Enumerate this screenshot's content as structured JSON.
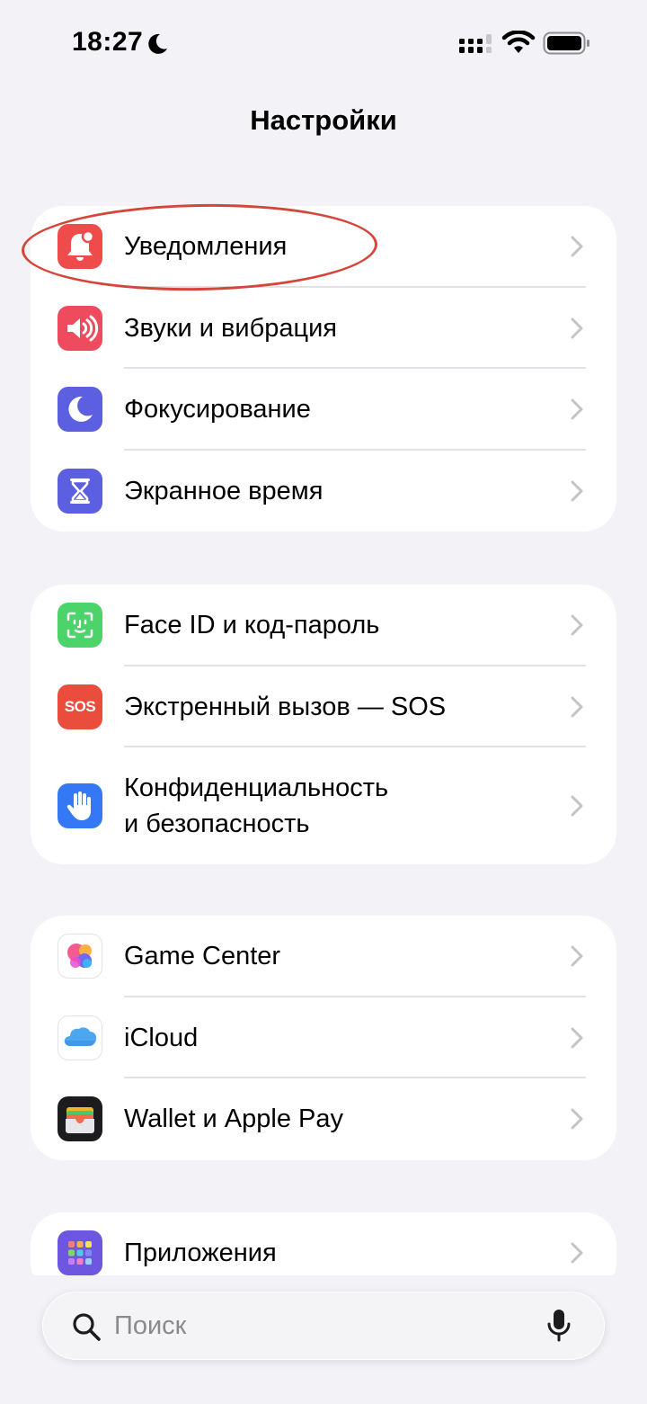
{
  "status_bar": {
    "time": "18:27",
    "icons": [
      "moon-icon",
      "cellular-signal-icon",
      "wifi-icon",
      "battery-icon"
    ]
  },
  "header": {
    "title": "Настройки"
  },
  "groups": [
    {
      "items": [
        {
          "label": "Уведомления",
          "icon": "bell-icon",
          "icon_color": "#ef4b4b",
          "highlighted": true
        },
        {
          "label": "Звуки и вибрация",
          "icon": "speaker-icon",
          "icon_color": "#ef4b5e"
        },
        {
          "label": "Фокусирование",
          "icon": "moon-icon",
          "icon_color": "#5b5fe0"
        },
        {
          "label": "Экранное время",
          "icon": "hourglass-icon",
          "icon_color": "#5b5fe0"
        }
      ]
    },
    {
      "items": [
        {
          "label": "Face ID и код-пароль",
          "icon": "face-id-icon",
          "icon_color": "#4cd36a"
        },
        {
          "label": "Экстренный вызов — SOS",
          "icon": "sos-icon",
          "icon_color": "#eb4d3d",
          "icon_text": "SOS"
        },
        {
          "label_line1": "Конфиденциальность",
          "label_line2": "и безопасность",
          "icon": "hand-icon",
          "icon_color": "#3478f6"
        }
      ]
    },
    {
      "items": [
        {
          "label": "Game Center",
          "icon": "game-center-icon",
          "icon_color": "#ffffff"
        },
        {
          "label": "iCloud",
          "icon": "cloud-icon",
          "icon_color": "#ffffff"
        },
        {
          "label": "Wallet и Apple Pay",
          "icon": "wallet-icon",
          "icon_color": "#1c1c1e"
        }
      ]
    },
    {
      "items": [
        {
          "label": "Приложения",
          "icon": "apps-grid-icon",
          "icon_color": "#6e57e0"
        }
      ]
    }
  ],
  "search": {
    "placeholder": "Поиск",
    "value": ""
  },
  "colors": {
    "background": "#f2f2f7",
    "highlight_ellipse": "#d5463a",
    "chevron": "#c4c4c7"
  }
}
